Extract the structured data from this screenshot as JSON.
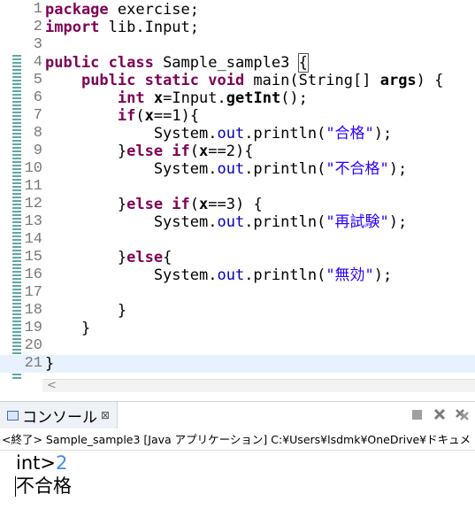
{
  "editor": {
    "lines": [
      {
        "n": "1",
        "segs": [
          [
            "kw",
            "package"
          ],
          [
            "",
            "exercise;"
          ]
        ]
      },
      {
        "n": "2",
        "segs": [
          [
            "kw",
            "import"
          ],
          [
            "",
            "lib.Input;"
          ]
        ]
      },
      {
        "n": "3",
        "segs": []
      },
      {
        "n": "4",
        "segs": [
          [
            "kw",
            "public class"
          ],
          [
            "",
            "Sample_sample3 "
          ],
          [
            "box",
            "{"
          ]
        ]
      },
      {
        "n": "5",
        "segs": [
          [
            "",
            "    "
          ],
          [
            "kw",
            "public static void"
          ],
          [
            "",
            " main(String[] "
          ],
          [
            "bold",
            "args"
          ],
          [
            "",
            ") {"
          ]
        ]
      },
      {
        "n": "6",
        "segs": [
          [
            "",
            "        "
          ],
          [
            "kw",
            "int"
          ],
          [
            "",
            " "
          ],
          [
            "bold",
            "x"
          ],
          [
            "",
            "=Input."
          ],
          [
            "bold",
            "getInt"
          ],
          [
            "",
            "();"
          ]
        ]
      },
      {
        "n": "7",
        "segs": [
          [
            "",
            "        "
          ],
          [
            "kw",
            "if"
          ],
          [
            "",
            "("
          ],
          [
            "bold",
            "x"
          ],
          [
            "",
            "==1){"
          ]
        ]
      },
      {
        "n": "8",
        "segs": [
          [
            "",
            "            System."
          ],
          [
            "fld",
            "out"
          ],
          [
            "",
            ".println("
          ],
          [
            "str",
            "\"合格\""
          ],
          [
            "",
            ");"
          ]
        ]
      },
      {
        "n": "9",
        "segs": [
          [
            "",
            "        }"
          ],
          [
            "kw",
            "else if"
          ],
          [
            "",
            "("
          ],
          [
            "bold",
            "x"
          ],
          [
            "",
            "==2){"
          ]
        ]
      },
      {
        "n": "10",
        "segs": [
          [
            "",
            "            System."
          ],
          [
            "fld",
            "out"
          ],
          [
            "",
            ".println("
          ],
          [
            "str",
            "\"不合格\""
          ],
          [
            "",
            ");"
          ]
        ]
      },
      {
        "n": "11",
        "segs": []
      },
      {
        "n": "12",
        "segs": [
          [
            "",
            "        }"
          ],
          [
            "kw",
            "else if"
          ],
          [
            "",
            "("
          ],
          [
            "bold",
            "x"
          ],
          [
            "",
            "==3) {"
          ]
        ]
      },
      {
        "n": "13",
        "segs": [
          [
            "",
            "            System."
          ],
          [
            "fld",
            "out"
          ],
          [
            "",
            ".println("
          ],
          [
            "str",
            "\"再試験\""
          ],
          [
            "",
            ");"
          ]
        ]
      },
      {
        "n": "14",
        "segs": []
      },
      {
        "n": "15",
        "segs": [
          [
            "",
            "        }"
          ],
          [
            "kw",
            "else"
          ],
          [
            "",
            "{"
          ]
        ]
      },
      {
        "n": "16",
        "segs": [
          [
            "",
            "            System."
          ],
          [
            "fld",
            "out"
          ],
          [
            "",
            ".println("
          ],
          [
            "str",
            "\"無効\""
          ],
          [
            "",
            ");"
          ]
        ]
      },
      {
        "n": "17",
        "segs": []
      },
      {
        "n": "18",
        "segs": [
          [
            "",
            "        }"
          ]
        ]
      },
      {
        "n": "19",
        "segs": [
          [
            "",
            "    }"
          ]
        ]
      },
      {
        "n": "20",
        "segs": []
      },
      {
        "n": "21",
        "segs": [
          [
            "",
            "}"
          ]
        ]
      }
    ],
    "highlight_line": "21",
    "scroll_arrow": "<"
  },
  "console": {
    "tab_label": "コンソール",
    "tab_close": "⊠",
    "status_line": "<終了> Sample_sample3 [Java アプリケーション] C:¥Users¥lsdmk¥OneDrive¥ドキュメ",
    "prompt": "int>",
    "input_value": "2",
    "output": "不合格",
    "toolbar_icons": [
      "terminate-icon",
      "remove-launch-icon",
      "remove-all-icon"
    ]
  },
  "colors": {
    "keyword": "#7f0055",
    "string": "#2a00ff",
    "field": "#0000c0",
    "input_echo": "#3c8ce6",
    "change_bar": "#5fa8a0"
  }
}
